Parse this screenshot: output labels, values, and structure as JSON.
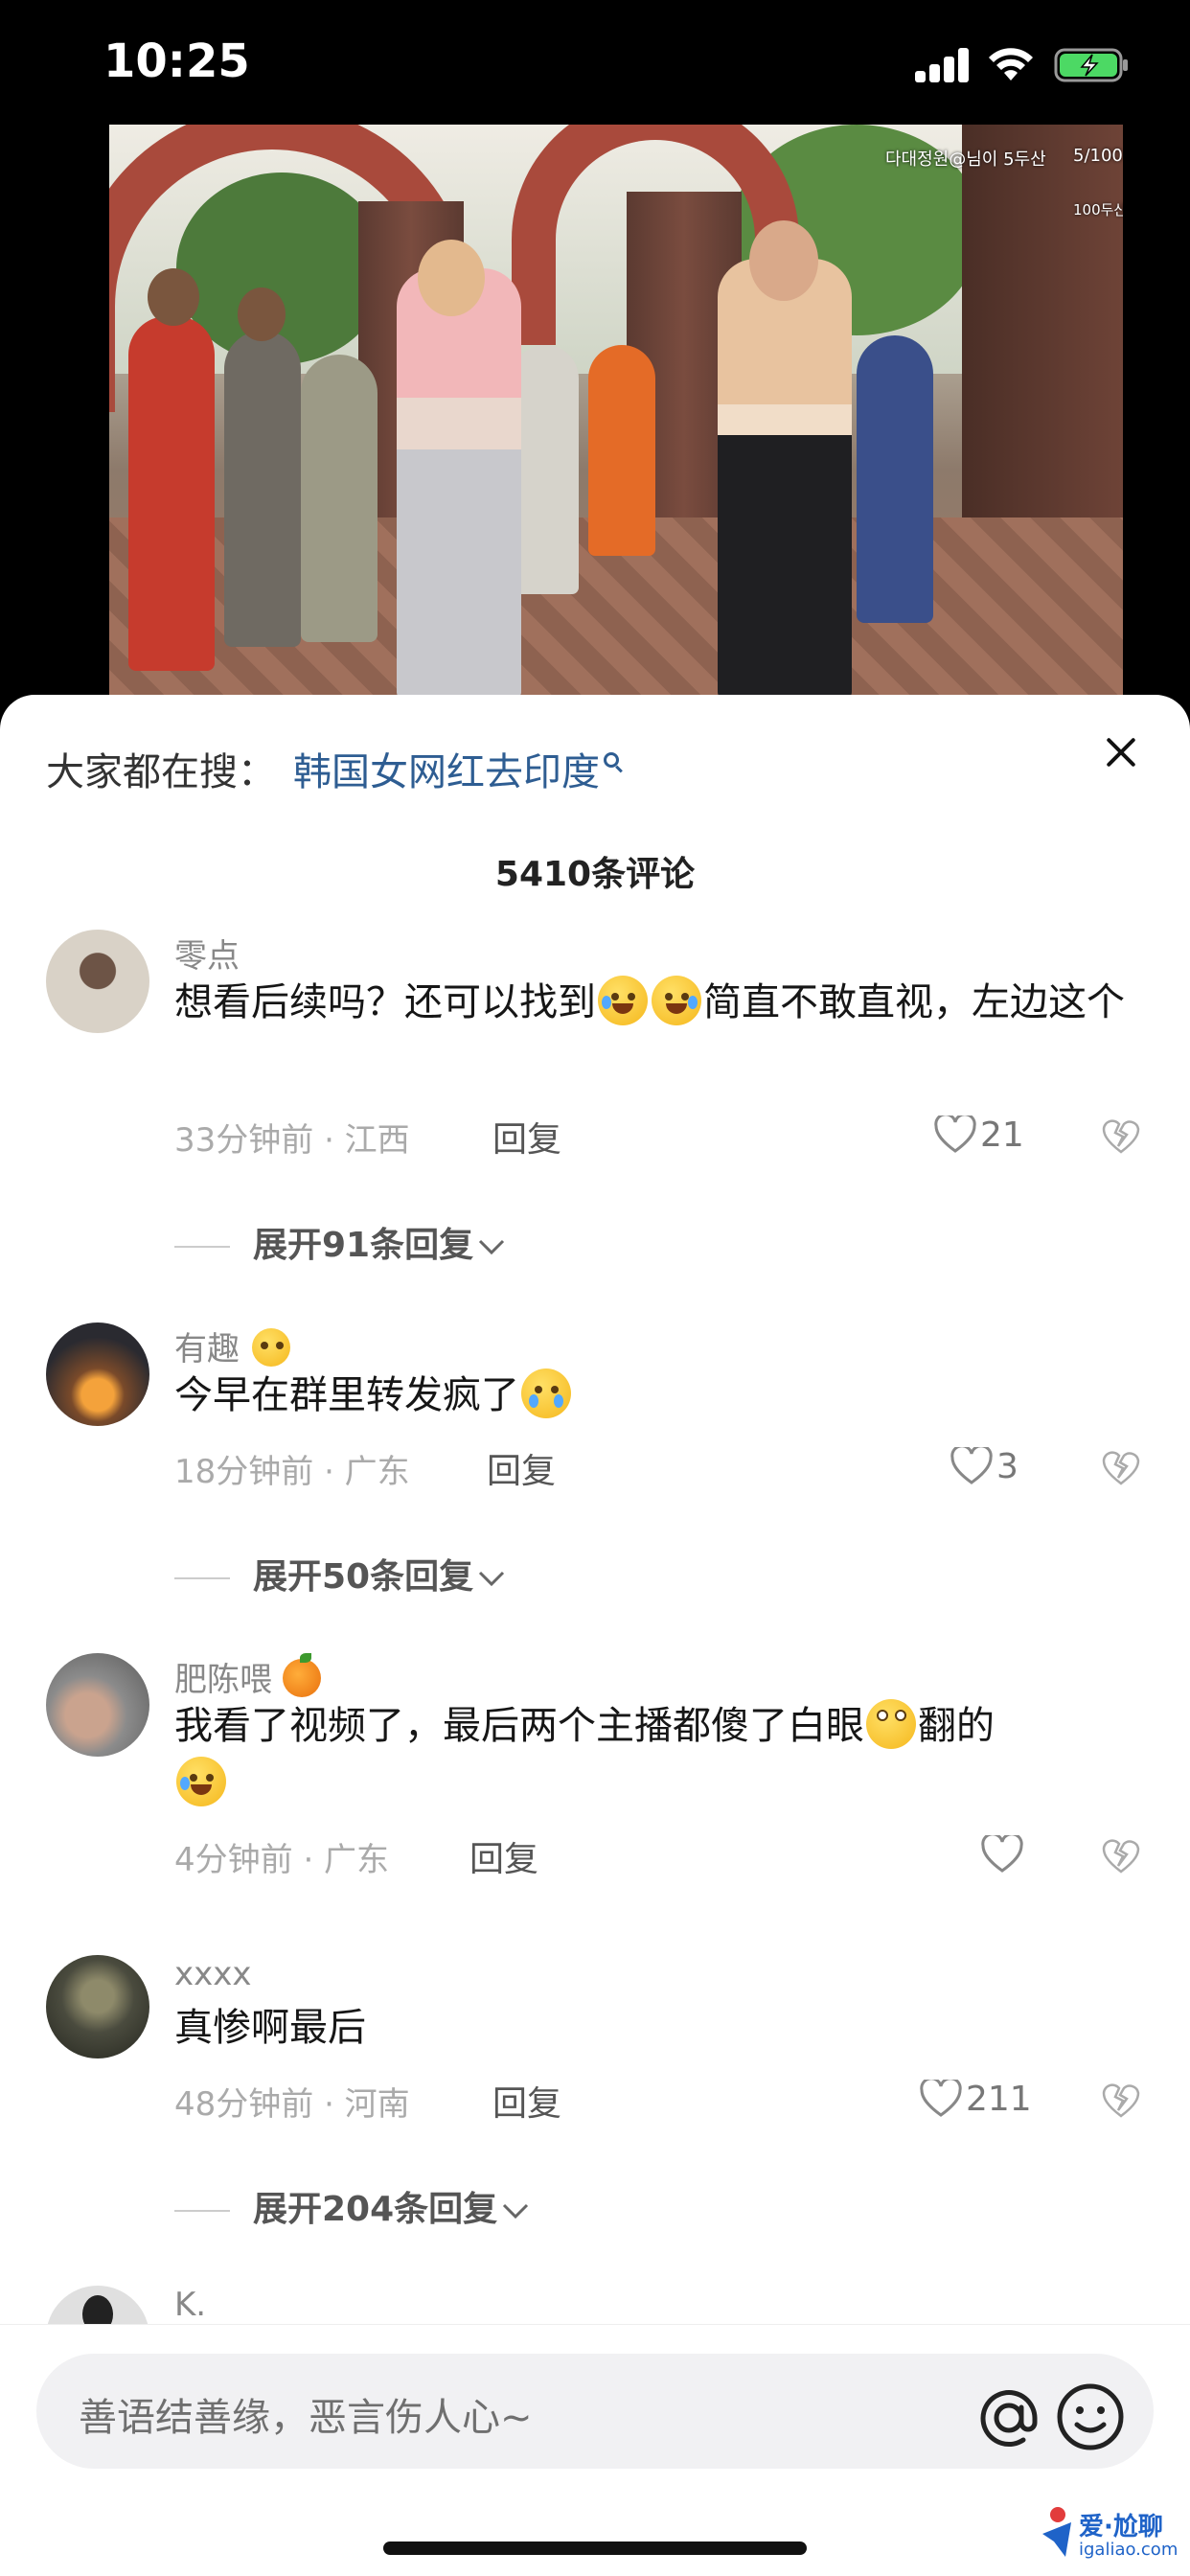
{
  "status_bar": {
    "time": "10:25"
  },
  "video": {
    "overlay_top": "다대정원@님이 5두산",
    "overlay_counter": "5/100",
    "overlay_sub": "100두산"
  },
  "search": {
    "prefix": "大家都在搜：",
    "term": "韩国女网红去印度"
  },
  "comments_header": {
    "count_label": "5410条评论"
  },
  "comments": [
    {
      "name": "零点",
      "text_before": "想看后续吗？还可以找到",
      "text_after": "简直不敢直视，左边这个",
      "meta": "33分钟前 · 江西",
      "reply_label": "回复",
      "likes": "21",
      "expand_label": "展开91条回复"
    },
    {
      "name": "有趣",
      "text_before": "今早在群里转发疯了",
      "meta": "18分钟前 · 广东",
      "reply_label": "回复",
      "likes": "3",
      "expand_label": "展开50条回复"
    },
    {
      "name": "肥陈喂",
      "text_before": "我看了视频了，最后两个主播都傻了白眼",
      "text_after": "翻的",
      "meta": "4分钟前 · 广东",
      "reply_label": "回复",
      "likes": ""
    },
    {
      "name": "xxxx",
      "text_before": "真惨啊最后",
      "meta": "48分钟前 · 河南",
      "reply_label": "回复",
      "likes": "211",
      "expand_label": "展开204条回复"
    },
    {
      "name": "K."
    }
  ],
  "input": {
    "placeholder": "善语结善缘，恶言伤人心~"
  },
  "watermark": {
    "text": "爱·尬聊",
    "sub": "igaliao.com"
  },
  "icons": {
    "close": "close-icon",
    "heart": "heart-icon",
    "dislike": "broken-heart-icon",
    "chevron": "chevron-down-icon",
    "at": "at-icon",
    "emoji": "emoji-icon",
    "search": "search-icon"
  },
  "colors": {
    "link": "#2e5d92",
    "sheet_bg": "#ffffff",
    "screen_bg": "#000000"
  }
}
